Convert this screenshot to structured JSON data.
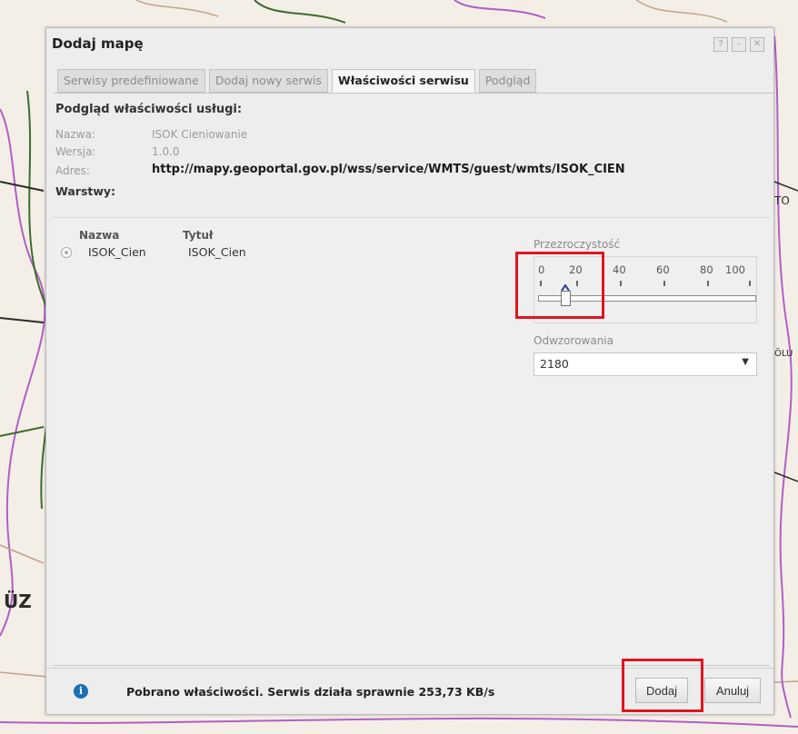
{
  "map": {
    "labels": [
      "ÜZ",
      "TO",
      "ÖLU"
    ]
  },
  "dialog": {
    "title": "Dodaj mapę",
    "title_buttons": [
      "?",
      "–",
      "✕"
    ],
    "tabs": [
      {
        "label": "Serwisy predefiniowane",
        "active": false
      },
      {
        "label": "Dodaj nowy serwis",
        "active": false
      },
      {
        "label": "Właściwości serwisu",
        "active": true
      },
      {
        "label": "Podgląd",
        "active": false
      }
    ],
    "props": {
      "heading": "Podgląd właściwości usługi:",
      "name_label": "Nazwa:",
      "name_value": "ISOK Cieniowanie",
      "version_label": "Wersja:",
      "version_value": "1.0.0",
      "address_label": "Adres:",
      "address_value": "http://mapy.geoportal.gov.pl/wss/service/WMTS/guest/wmts/ISOK_CIEN",
      "layers_label": "Warstwy:"
    },
    "layers_table": {
      "columns": [
        "Nazwa",
        "Tytuł"
      ],
      "rows": [
        {
          "name": "ISOK_Cien",
          "title": "ISOK_Cien",
          "selected": true
        }
      ]
    },
    "opacity": {
      "label": "Przezroczystość",
      "ticks": [
        "0",
        "20",
        "40",
        "60",
        "80",
        "100"
      ],
      "value": 12
    },
    "projection": {
      "label": "Odwzorowania",
      "selected": "2180"
    },
    "footer": {
      "status": "Pobrano właściwości. Serwis działa sprawnie 253,73 KB/s",
      "add_label": "Dodaj",
      "cancel_label": "Anuluj"
    }
  },
  "colors": {
    "highlight": "#e1141f",
    "info_icon": "#1a6fb5"
  }
}
